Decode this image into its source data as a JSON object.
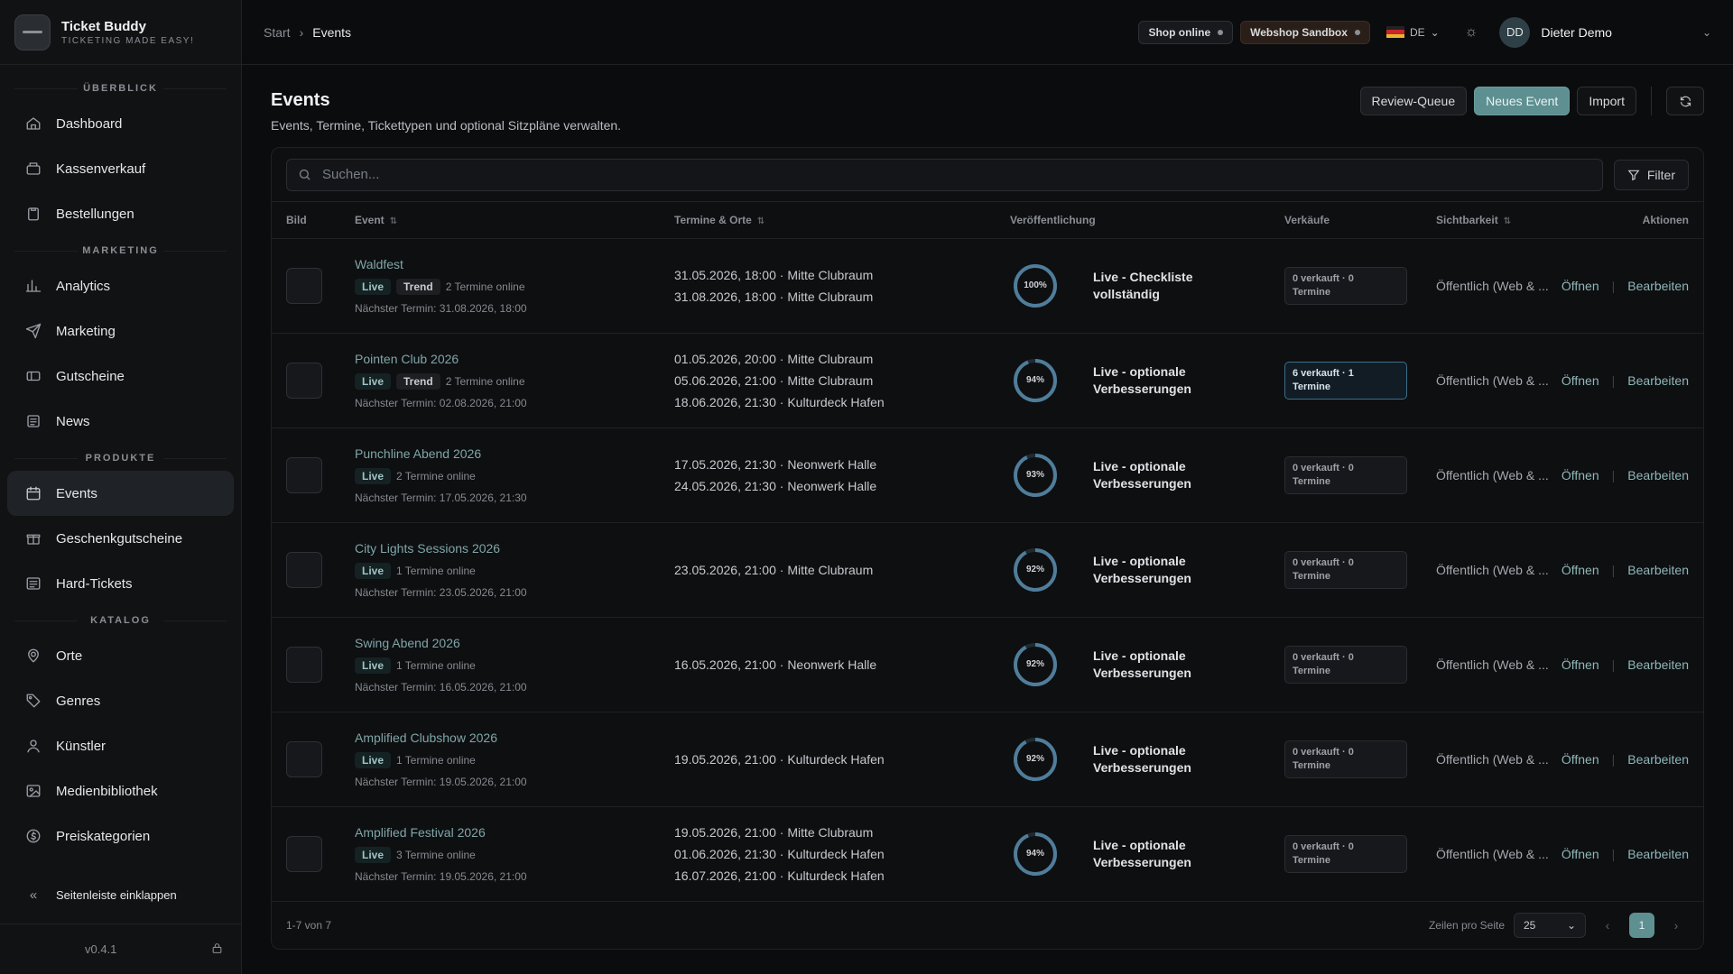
{
  "brand": {
    "name": "Ticket Buddy",
    "tagline": "TICKETING MADE EASY!"
  },
  "sidebar": {
    "sections": [
      {
        "title": "ÜBERBLICK",
        "items": [
          {
            "label": "Dashboard",
            "icon": "home-icon"
          },
          {
            "label": "Kassenverkauf",
            "icon": "register-icon"
          },
          {
            "label": "Bestellungen",
            "icon": "clipboard-icon"
          }
        ]
      },
      {
        "title": "MARKETING",
        "items": [
          {
            "label": "Analytics",
            "icon": "bar-chart-icon"
          },
          {
            "label": "Marketing",
            "icon": "send-icon"
          },
          {
            "label": "Gutscheine",
            "icon": "ticket-icon"
          },
          {
            "label": "News",
            "icon": "news-icon"
          }
        ]
      },
      {
        "title": "PRODUKTE",
        "items": [
          {
            "label": "Events",
            "icon": "calendar-icon",
            "active": true
          },
          {
            "label": "Geschenkgutscheine",
            "icon": "gift-icon"
          },
          {
            "label": "Hard-Tickets",
            "icon": "list-icon"
          }
        ]
      },
      {
        "title": "KATALOG",
        "items": [
          {
            "label": "Orte",
            "icon": "map-pin-icon"
          },
          {
            "label": "Genres",
            "icon": "tag-icon"
          },
          {
            "label": "Künstler",
            "icon": "user-icon"
          },
          {
            "label": "Medienbibliothek",
            "icon": "image-icon"
          },
          {
            "label": "Preiskategorien",
            "icon": "coin-icon"
          }
        ]
      }
    ],
    "collapse_label": "Seitenleiste einklappen",
    "version": "v0.4.1"
  },
  "topbar": {
    "breadcrumb": [
      "Start",
      "Events"
    ],
    "shop_status": "Shop online",
    "sandbox": "Webshop Sandbox",
    "language": "DE",
    "user_initials": "DD",
    "user_name": "Dieter Demo"
  },
  "page": {
    "title": "Events",
    "subtitle": "Events, Termine, Tickettypen und optional Sitzpläne verwalten.",
    "buttons": {
      "review": "Review-Queue",
      "new": "Neues Event",
      "import": "Import"
    },
    "search_placeholder": "Suchen...",
    "filter_label": "Filter"
  },
  "table": {
    "columns": [
      "Bild",
      "Event",
      "Termine & Orte",
      "Veröffentlichung",
      "Verkäufe",
      "Sichtbarkeit",
      "Aktionen"
    ],
    "rows": [
      {
        "name": "Waldfest",
        "badges": [
          "Live",
          "Trend"
        ],
        "termine": "2 Termine online",
        "next": "Nächster Termin: 31.08.2026, 18:00",
        "dates": [
          "31.05.2026, 18:00 · Mitte Clubraum",
          "31.08.2026, 18:00 · Mitte Clubraum"
        ],
        "pct": 100,
        "pct_label": "100%",
        "pub": [
          "Live - Checkliste",
          "vollständig"
        ],
        "sales": [
          "0 verkauft · 0",
          "Termine"
        ],
        "sales_hl": false,
        "vis": "Öffentlich (Web & ...",
        "open": "Öffnen",
        "edit": "Bearbeiten"
      },
      {
        "name": "Pointen Club 2026",
        "badges": [
          "Live",
          "Trend"
        ],
        "termine": "2 Termine online",
        "next": "Nächster Termin: 02.08.2026, 21:00",
        "dates": [
          "01.05.2026, 20:00 · Mitte Clubraum",
          "05.06.2026, 21:00 · Mitte Clubraum",
          "18.06.2026, 21:30 · Kulturdeck Hafen"
        ],
        "pct": 94,
        "pct_label": "94%",
        "pub": [
          "Live - optionale",
          "Verbesserungen"
        ],
        "sales": [
          "6 verkauft · 1",
          "Termine"
        ],
        "sales_hl": true,
        "vis": "Öffentlich (Web & ...",
        "open": "Öffnen",
        "edit": "Bearbeiten"
      },
      {
        "name": "Punchline Abend 2026",
        "badges": [
          "Live"
        ],
        "termine": "2 Termine online",
        "next": "Nächster Termin: 17.05.2026, 21:30",
        "dates": [
          "17.05.2026, 21:30 · Neonwerk Halle",
          "24.05.2026, 21:30 · Neonwerk Halle"
        ],
        "pct": 93,
        "pct_label": "93%",
        "pub": [
          "Live - optionale",
          "Verbesserungen"
        ],
        "sales": [
          "0 verkauft · 0",
          "Termine"
        ],
        "sales_hl": false,
        "vis": "Öffentlich (Web & ...",
        "open": "Öffnen",
        "edit": "Bearbeiten"
      },
      {
        "name": "City Lights Sessions 2026",
        "badges": [
          "Live"
        ],
        "termine": "1 Termine online",
        "next": "Nächster Termin: 23.05.2026, 21:00",
        "dates": [
          "23.05.2026, 21:00 · Mitte Clubraum"
        ],
        "pct": 92,
        "pct_label": "92%",
        "pub": [
          "Live - optionale",
          "Verbesserungen"
        ],
        "sales": [
          "0 verkauft · 0",
          "Termine"
        ],
        "sales_hl": false,
        "vis": "Öffentlich (Web & ...",
        "open": "Öffnen",
        "edit": "Bearbeiten"
      },
      {
        "name": "Swing Abend 2026",
        "badges": [
          "Live"
        ],
        "termine": "1 Termine online",
        "next": "Nächster Termin: 16.05.2026, 21:00",
        "dates": [
          "16.05.2026, 21:00 · Neonwerk Halle"
        ],
        "pct": 92,
        "pct_label": "92%",
        "pub": [
          "Live - optionale",
          "Verbesserungen"
        ],
        "sales": [
          "0 verkauft · 0",
          "Termine"
        ],
        "sales_hl": false,
        "vis": "Öffentlich (Web & ...",
        "open": "Öffnen",
        "edit": "Bearbeiten"
      },
      {
        "name": "Amplified Clubshow 2026",
        "badges": [
          "Live"
        ],
        "termine": "1 Termine online",
        "next": "Nächster Termin: 19.05.2026, 21:00",
        "dates": [
          "19.05.2026, 21:00 · Kulturdeck Hafen"
        ],
        "pct": 92,
        "pct_label": "92%",
        "pub": [
          "Live - optionale",
          "Verbesserungen"
        ],
        "sales": [
          "0 verkauft · 0",
          "Termine"
        ],
        "sales_hl": false,
        "vis": "Öffentlich (Web & ...",
        "open": "Öffnen",
        "edit": "Bearbeiten"
      },
      {
        "name": "Amplified Festival 2026",
        "badges": [
          "Live"
        ],
        "termine": "3 Termine online",
        "next": "Nächster Termin: 19.05.2026, 21:00",
        "dates": [
          "19.05.2026, 21:00 · Mitte Clubraum",
          "01.06.2026, 21:30 · Kulturdeck Hafen",
          "16.07.2026, 21:00 · Kulturdeck Hafen"
        ],
        "pct": 94,
        "pct_label": "94%",
        "pub": [
          "Live - optionale",
          "Verbesserungen"
        ],
        "sales": [
          "0 verkauft · 0",
          "Termine"
        ],
        "sales_hl": false,
        "vis": "Öffentlich (Web & ...",
        "open": "Öffnen",
        "edit": "Bearbeiten"
      }
    ]
  },
  "pagination": {
    "summary": "1-7 von 7",
    "rows_label": "Zeilen pro Seite",
    "rows_value": "25",
    "current_page": "1"
  },
  "colors": {
    "accent": "#5e8f91",
    "link": "#8fb7ba",
    "ring": "#4f7d9a"
  }
}
